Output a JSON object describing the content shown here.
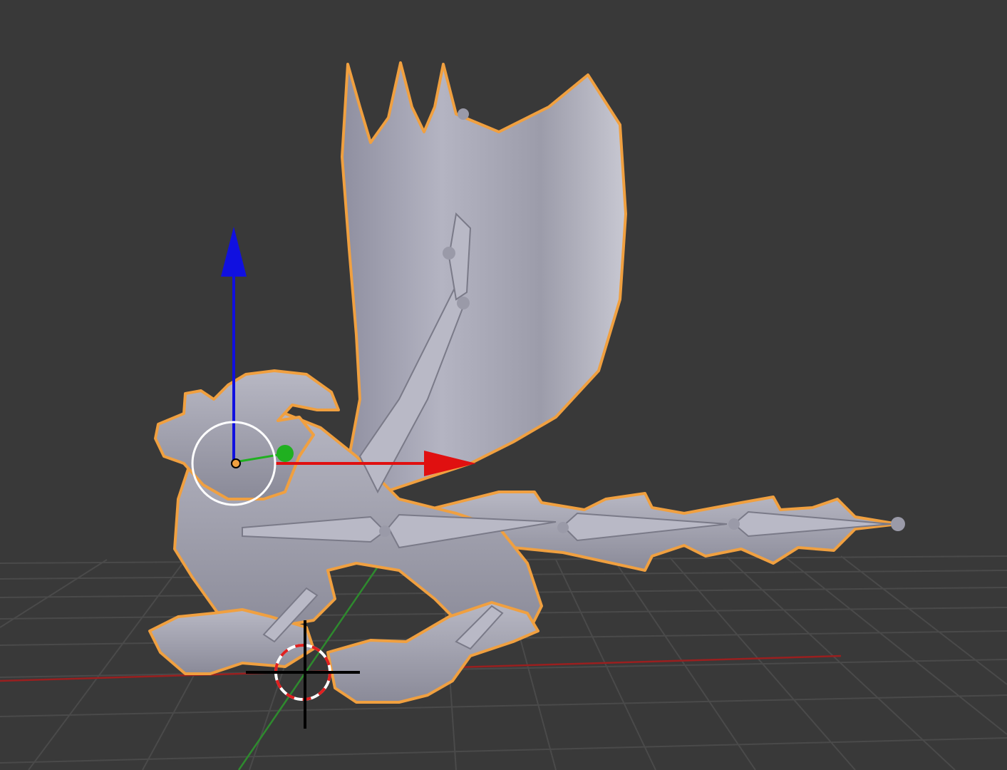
{
  "app": "3D viewport",
  "viewport": {
    "background_color": "#393939",
    "grid_color": "#4a4a4a",
    "axis_x_color": "#9a1f1f",
    "axis_y_color": "#2e8a2e"
  },
  "selected_object": {
    "type": "armature-with-mesh",
    "outline_color": "#f0a040",
    "mesh_color": "#a3a3b3"
  },
  "gizmo": {
    "mode": "translate",
    "x_color": "#e01010",
    "y_color": "#20b020",
    "z_color": "#1010e0",
    "pivot_ring_color": "#ffffff"
  },
  "cursor_3d": {
    "ring_colors": [
      "#e02020",
      "#ffffff"
    ],
    "crosshair_color": "#000000"
  }
}
